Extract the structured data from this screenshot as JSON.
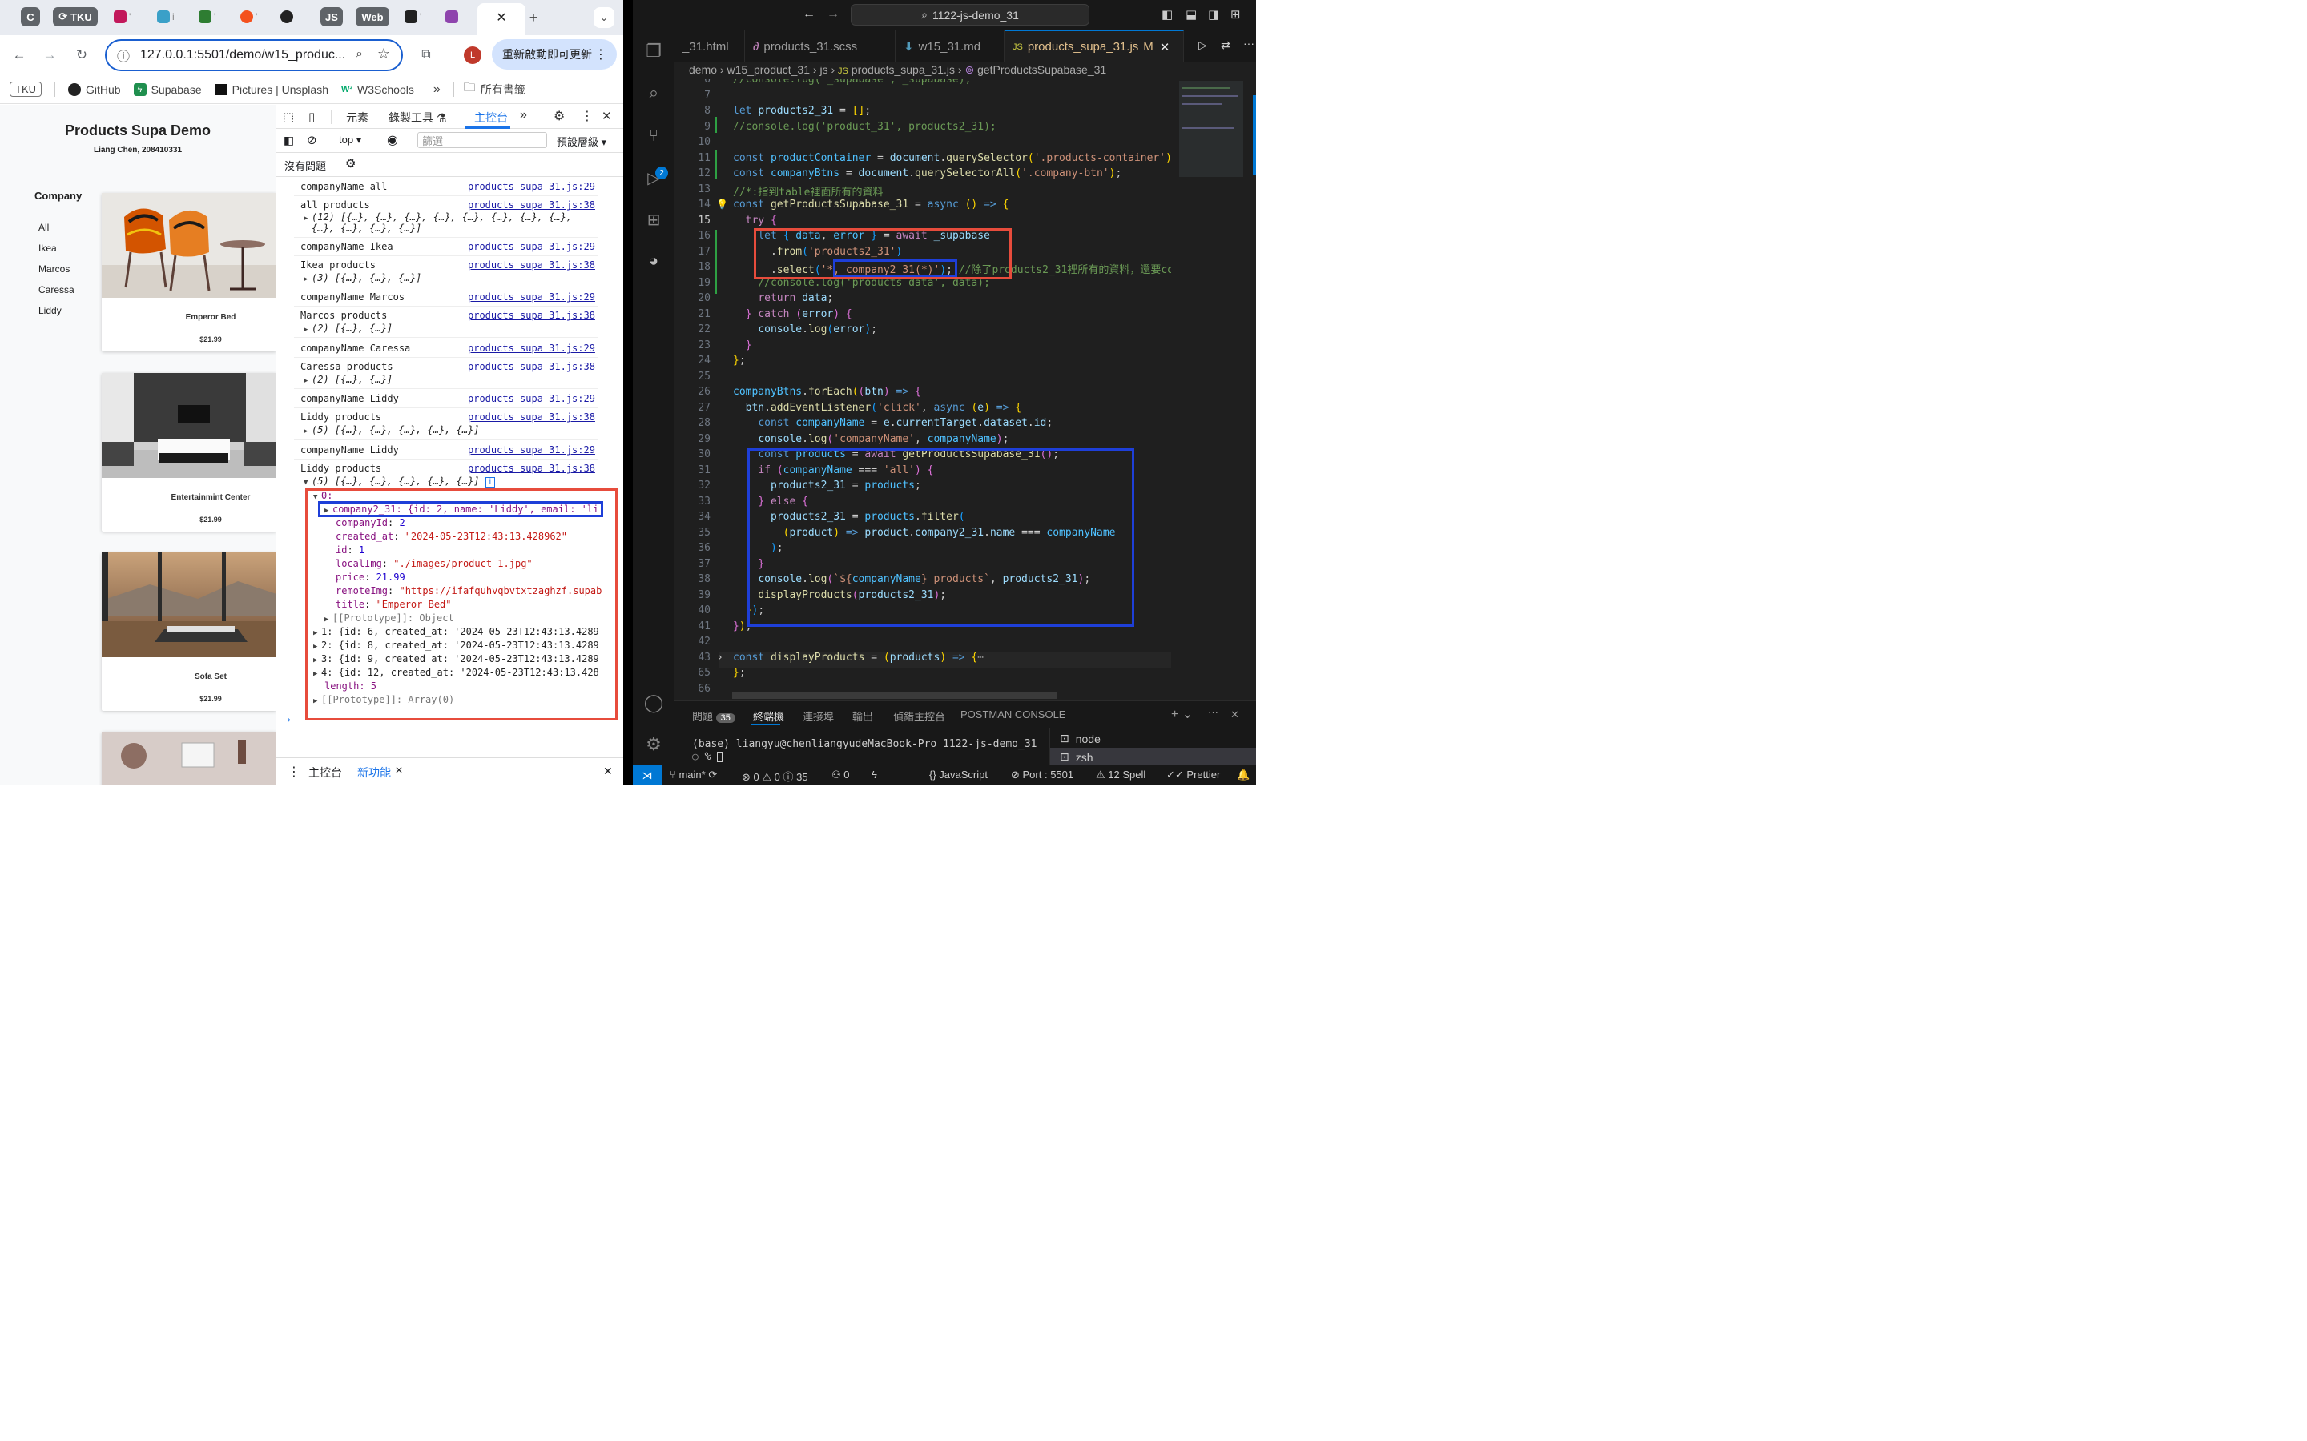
{
  "browser": {
    "tabs": [
      {
        "label": "C",
        "color": "#5f6368"
      },
      {
        "label": "TKU",
        "color": "#5f6368"
      },
      {
        "label": "JS",
        "color": "#5f6368"
      },
      {
        "label": "Web",
        "color": "#5f6368"
      }
    ],
    "new_tab": "+",
    "close_tab": "✕",
    "url": "127.0.0.1:5501/demo/w15_produc...",
    "update_button": "重新啟動即可更新",
    "profile_initial": "L",
    "bookmarks": [
      {
        "label": "TKU"
      },
      {
        "label": "GitHub"
      },
      {
        "label": "Supabase"
      },
      {
        "label": "Pictures | Unsplash"
      },
      {
        "label": "W3Schools"
      }
    ],
    "all_bookmarks": "所有書籤"
  },
  "page": {
    "title": "Products Supa Demo",
    "subtitle": "Liang Chen, 208410331",
    "company_heading": "Company",
    "companies": [
      "All",
      "Ikea",
      "Marcos",
      "Caressa",
      "Liddy"
    ],
    "products": [
      {
        "title": "Emperor Bed",
        "price": "$21.99"
      },
      {
        "title": "Entertainmint Center",
        "price": "$21.99"
      },
      {
        "title": "Sofa Set",
        "price": "$21.99"
      }
    ]
  },
  "devtools": {
    "tabs": {
      "elements": "元素",
      "recorder": "錄製工具 ⚗",
      "console": "主控台"
    },
    "context": "top",
    "filter_placeholder": "篩選",
    "levels": "預設層級",
    "no_issues": "沒有問題",
    "logs": [
      {
        "text": "companyName all",
        "src": "products supa 31.js:29"
      },
      {
        "text": "all products",
        "src": "products supa 31.js:38",
        "detail": "(12) [{…}, {…}, {…}, {…}, {…}, {…}, {…}, {…},",
        "detail2": "{…}, {…}, {…}, {…}]"
      },
      {
        "text": "companyName Ikea",
        "src": "products supa 31.js:29"
      },
      {
        "text": "Ikea products",
        "src": "products supa 31.js:38",
        "detail": "(3) [{…}, {…}, {…}]"
      },
      {
        "text": "companyName Marcos",
        "src": "products supa 31.js:29"
      },
      {
        "text": "Marcos products",
        "src": "products supa 31.js:38",
        "detail": "(2) [{…}, {…}]"
      },
      {
        "text": "companyName Caressa",
        "src": "products supa 31.js:29"
      },
      {
        "text": "Caressa products",
        "src": "products supa 31.js:38",
        "detail": "(2) [{…}, {…}]"
      },
      {
        "text": "companyName Liddy",
        "src": "products supa 31.js:29"
      },
      {
        "text": "Liddy products",
        "src": "products supa 31.js:38",
        "detail": "(5) [{…}, {…}, {…}, {…}, {…}]"
      },
      {
        "text": "companyName Liddy",
        "src": "products supa 31.js:29"
      },
      {
        "text": "Liddy products",
        "src": "products supa 31.js:38",
        "detail": "(5) [{…}, {…}, {…}, {…}, {…}]"
      }
    ],
    "expanded": {
      "index0": "0:",
      "company_row": "company2_31: {id: 2, name: 'Liddy', email: 'li",
      "fields": [
        {
          "key": "companyId",
          "value": "2",
          "kind": "num"
        },
        {
          "key": "created_at",
          "value": "\"2024-05-23T12:43:13.428962\"",
          "kind": "str"
        },
        {
          "key": "id",
          "value": "1",
          "kind": "num"
        },
        {
          "key": "localImg",
          "value": "\"./images/product-1.jpg\"",
          "kind": "str"
        },
        {
          "key": "price",
          "value": "21.99",
          "kind": "num"
        },
        {
          "key": "remoteImg",
          "value": "\"https://ifafquhvqbvtxtzaghzf.supab",
          "kind": "str"
        },
        {
          "key": "title",
          "value": "\"Emperor Bed\"",
          "kind": "str"
        }
      ],
      "prototype_obj": "[[Prototype]]: Object",
      "items": [
        "1: {id: 6, created_at: '2024-05-23T12:43:13.4289",
        "2: {id: 8, created_at: '2024-05-23T12:43:13.4289",
        "3: {id: 9, created_at: '2024-05-23T12:43:13.4289",
        "4: {id: 12, created_at: '2024-05-23T12:43:13.428"
      ],
      "length": "length: 5",
      "prototype_arr": "[[Prototype]]: Array(0)"
    },
    "drawer": {
      "console": "主控台",
      "whats_new": "新功能"
    }
  },
  "vscode": {
    "command_center": "1122-js-demo_31",
    "scm_badge": "2",
    "tabs": [
      {
        "label": "_31.html"
      },
      {
        "label": "products_31.scss"
      },
      {
        "label": "w15_31.md"
      },
      {
        "label": "products_supa_31.js",
        "mod": "M"
      }
    ],
    "breadcrumb": [
      "demo",
      "w15_product_31",
      "js",
      "products_supa_31.js",
      "getProductsSupabase_31"
    ],
    "panel_tabs": {
      "problems": "問題",
      "problems_count": "35",
      "terminal": "終端機",
      "ports": "連接埠",
      "output": "輸出",
      "debug": "偵錯主控台",
      "postman": "POSTMAN CONSOLE"
    },
    "terminal_line1": "(base) liangyu@chenliangyudeMacBook-Pro 1122-js-demo_31",
    "terminal_line2": "%",
    "terminals": [
      "node",
      "zsh"
    ],
    "status": {
      "branch": "main*",
      "errors": "0",
      "warnings": "0",
      "infos": "35",
      "ports": "0",
      "language": "JavaScript",
      "port": "Port : 5501",
      "spell": "12 Spell",
      "prettier": "Prettier"
    }
  }
}
